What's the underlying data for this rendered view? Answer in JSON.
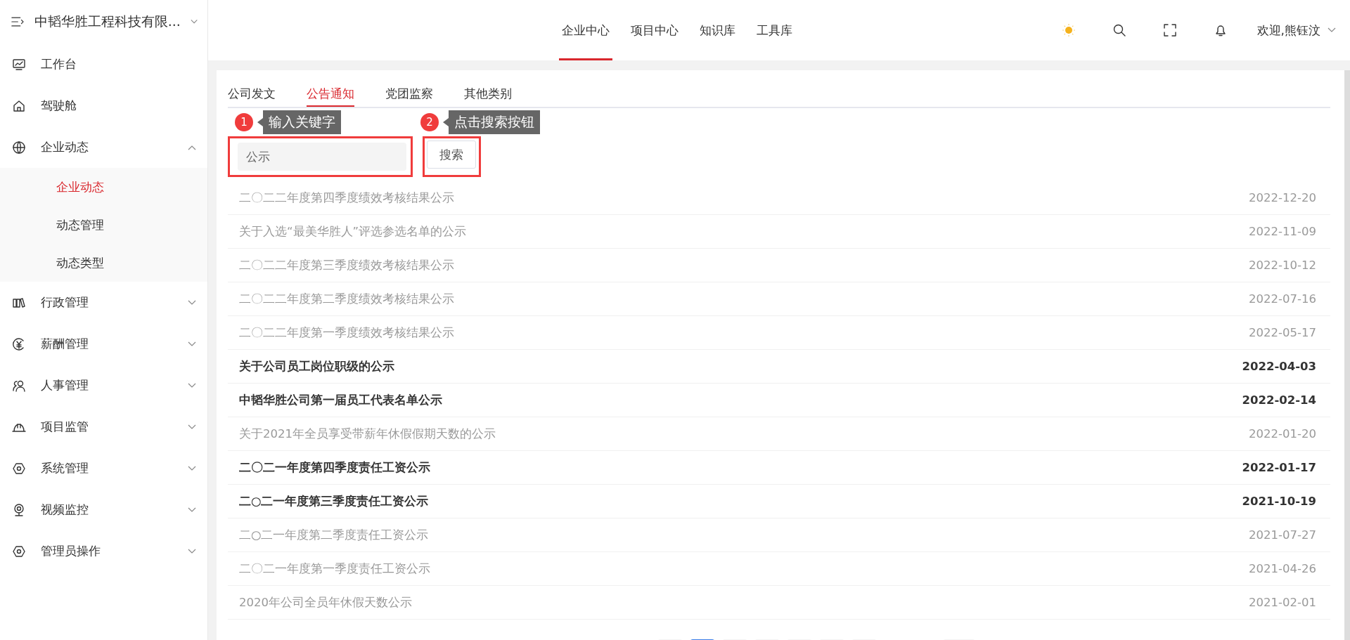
{
  "sidebar": {
    "company": "中韬华胜工程科技有限...",
    "items": [
      {
        "label": "工作台"
      },
      {
        "label": "驾驶舱"
      },
      {
        "label": "企业动态",
        "expanded": true,
        "children": [
          {
            "label": "企业动态",
            "selected": true
          },
          {
            "label": "动态管理",
            "selected": false
          },
          {
            "label": "动态类型",
            "selected": false
          }
        ]
      },
      {
        "label": "行政管理",
        "expanded": false
      },
      {
        "label": "薪酬管理",
        "expanded": false
      },
      {
        "label": "人事管理",
        "expanded": false
      },
      {
        "label": "项目监管",
        "expanded": false
      },
      {
        "label": "系统管理",
        "expanded": false
      },
      {
        "label": "视频监控",
        "expanded": false
      },
      {
        "label": "管理员操作",
        "expanded": false
      }
    ]
  },
  "top_nav": [
    {
      "label": "企业中心",
      "selected": true
    },
    {
      "label": "项目中心",
      "selected": false
    },
    {
      "label": "知识库",
      "selected": false
    },
    {
      "label": "工具库",
      "selected": false
    }
  ],
  "user": {
    "greeting": "欢迎,熊钰汶"
  },
  "category_tabs": [
    {
      "label": "公司发文",
      "selected": false
    },
    {
      "label": "公告通知",
      "selected": true
    },
    {
      "label": "党团监察",
      "selected": false
    },
    {
      "label": "其他类别",
      "selected": false
    }
  ],
  "search": {
    "value": "公示",
    "button": "搜索"
  },
  "annotations": [
    {
      "number": "1",
      "text": "输入关键字"
    },
    {
      "number": "2",
      "text": "点击搜索按钮"
    }
  ],
  "notices": [
    {
      "title": "二〇二二年度第四季度绩效考核结果公示",
      "date": "2022-12-20",
      "read": true
    },
    {
      "title": "关于入选“最美华胜人”评选参选名单的公示",
      "date": "2022-11-09",
      "read": true
    },
    {
      "title": "二〇二二年度第三季度绩效考核结果公示",
      "date": "2022-10-12",
      "read": true
    },
    {
      "title": "二〇二二年度第二季度绩效考核结果公示",
      "date": "2022-07-16",
      "read": true
    },
    {
      "title": "二〇二二年度第一季度绩效考核结果公示",
      "date": "2022-05-17",
      "read": true
    },
    {
      "title": "关于公司员工岗位职级的公示",
      "date": "2022-04-03",
      "read": false
    },
    {
      "title": "中韬华胜公司第一届员工代表名单公示",
      "date": "2022-02-14",
      "read": false
    },
    {
      "title": "关于2021年全员享受带薪年休假假期天数的公示",
      "date": "2022-01-20",
      "read": true
    },
    {
      "title": "二〇二一年度第四季度责任工资公示",
      "date": "2022-01-17",
      "read": false
    },
    {
      "title": "二○二一年度第三季度责任工资公示",
      "date": "2021-10-19",
      "read": false
    },
    {
      "title": "二○二一年度第二季度责任工资公示",
      "date": "2021-07-27",
      "read": true
    },
    {
      "title": "二〇二一年度第一季度责任工资公示",
      "date": "2021-04-26",
      "read": true
    },
    {
      "title": "2020年公司全员年休假天数公示",
      "date": "2021-02-01",
      "read": true
    }
  ],
  "pagination": [
    {
      "selected": false
    },
    {
      "selected": true
    },
    {
      "selected": false
    },
    {
      "selected": false
    },
    {
      "selected": false
    },
    {
      "selected": false
    },
    {
      "selected": false
    },
    {
      "selected": false
    }
  ]
}
